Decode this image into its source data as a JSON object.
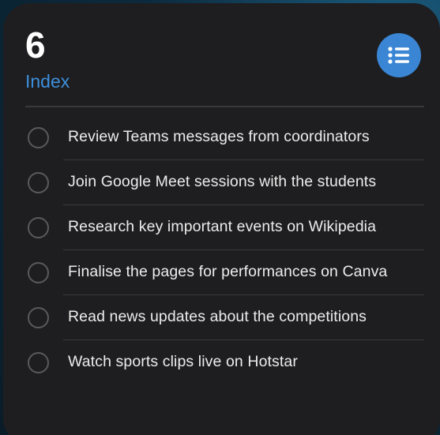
{
  "widget": {
    "count": "6",
    "list_name": "Index",
    "list_icon": "list-bullet-icon",
    "accent_color": "#3a86d4",
    "background_color": "#1e1e20"
  },
  "tasks": [
    {
      "label": "Review Teams messages from coordinators",
      "completed": false
    },
    {
      "label": "Join Google Meet sessions with the students",
      "completed": false
    },
    {
      "label": "Research key important events on Wikipedia",
      "completed": false
    },
    {
      "label": "Finalise the pages for performances on Canva",
      "completed": false
    },
    {
      "label": "Read news updates about the competitions",
      "completed": false
    },
    {
      "label": "Watch sports clips live on Hotstar",
      "completed": false
    }
  ]
}
